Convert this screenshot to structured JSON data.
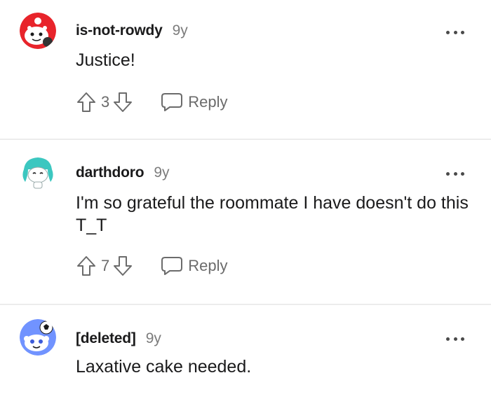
{
  "comments": [
    {
      "author": "is-not-rowdy",
      "age": "9y",
      "text": "Justice!",
      "votes": "3",
      "reply_label": "Reply",
      "avatar_icon": "snoo-red-avatar-icon"
    },
    {
      "author": "darthdoro",
      "age": "9y",
      "text": "I'm so grateful the roommate I have doesn't do this T_T",
      "votes": "7",
      "reply_label": "Reply",
      "avatar_icon": "snoo-teal-hair-avatar-icon"
    },
    {
      "author": "[deleted]",
      "age": "9y",
      "text": "Laxative cake needed.",
      "avatar_icon": "snoo-blue-avatar-icon"
    }
  ],
  "colors": {
    "text": "#1a1a1b",
    "muted": "#7c7c7c",
    "divider": "#ececec",
    "avatar_red": "#e8242b",
    "avatar_teal": "#3cc7c0",
    "avatar_blue": "#7193ff"
  }
}
